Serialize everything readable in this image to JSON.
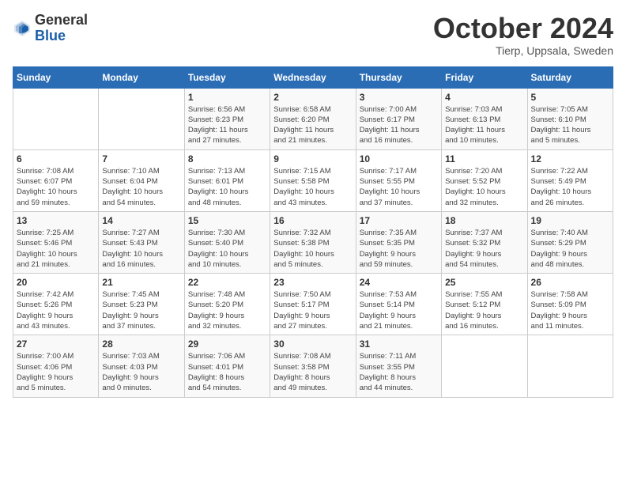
{
  "header": {
    "logo_general": "General",
    "logo_blue": "Blue",
    "month_title": "October 2024",
    "location": "Tierp, Uppsala, Sweden"
  },
  "calendar": {
    "days_of_week": [
      "Sunday",
      "Monday",
      "Tuesday",
      "Wednesday",
      "Thursday",
      "Friday",
      "Saturday"
    ],
    "weeks": [
      [
        {
          "day": "",
          "info": ""
        },
        {
          "day": "",
          "info": ""
        },
        {
          "day": "1",
          "info": "Sunrise: 6:56 AM\nSunset: 6:23 PM\nDaylight: 11 hours\nand 27 minutes."
        },
        {
          "day": "2",
          "info": "Sunrise: 6:58 AM\nSunset: 6:20 PM\nDaylight: 11 hours\nand 21 minutes."
        },
        {
          "day": "3",
          "info": "Sunrise: 7:00 AM\nSunset: 6:17 PM\nDaylight: 11 hours\nand 16 minutes."
        },
        {
          "day": "4",
          "info": "Sunrise: 7:03 AM\nSunset: 6:13 PM\nDaylight: 11 hours\nand 10 minutes."
        },
        {
          "day": "5",
          "info": "Sunrise: 7:05 AM\nSunset: 6:10 PM\nDaylight: 11 hours\nand 5 minutes."
        }
      ],
      [
        {
          "day": "6",
          "info": "Sunrise: 7:08 AM\nSunset: 6:07 PM\nDaylight: 10 hours\nand 59 minutes."
        },
        {
          "day": "7",
          "info": "Sunrise: 7:10 AM\nSunset: 6:04 PM\nDaylight: 10 hours\nand 54 minutes."
        },
        {
          "day": "8",
          "info": "Sunrise: 7:13 AM\nSunset: 6:01 PM\nDaylight: 10 hours\nand 48 minutes."
        },
        {
          "day": "9",
          "info": "Sunrise: 7:15 AM\nSunset: 5:58 PM\nDaylight: 10 hours\nand 43 minutes."
        },
        {
          "day": "10",
          "info": "Sunrise: 7:17 AM\nSunset: 5:55 PM\nDaylight: 10 hours\nand 37 minutes."
        },
        {
          "day": "11",
          "info": "Sunrise: 7:20 AM\nSunset: 5:52 PM\nDaylight: 10 hours\nand 32 minutes."
        },
        {
          "day": "12",
          "info": "Sunrise: 7:22 AM\nSunset: 5:49 PM\nDaylight: 10 hours\nand 26 minutes."
        }
      ],
      [
        {
          "day": "13",
          "info": "Sunrise: 7:25 AM\nSunset: 5:46 PM\nDaylight: 10 hours\nand 21 minutes."
        },
        {
          "day": "14",
          "info": "Sunrise: 7:27 AM\nSunset: 5:43 PM\nDaylight: 10 hours\nand 16 minutes."
        },
        {
          "day": "15",
          "info": "Sunrise: 7:30 AM\nSunset: 5:40 PM\nDaylight: 10 hours\nand 10 minutes."
        },
        {
          "day": "16",
          "info": "Sunrise: 7:32 AM\nSunset: 5:38 PM\nDaylight: 10 hours\nand 5 minutes."
        },
        {
          "day": "17",
          "info": "Sunrise: 7:35 AM\nSunset: 5:35 PM\nDaylight: 9 hours\nand 59 minutes."
        },
        {
          "day": "18",
          "info": "Sunrise: 7:37 AM\nSunset: 5:32 PM\nDaylight: 9 hours\nand 54 minutes."
        },
        {
          "day": "19",
          "info": "Sunrise: 7:40 AM\nSunset: 5:29 PM\nDaylight: 9 hours\nand 48 minutes."
        }
      ],
      [
        {
          "day": "20",
          "info": "Sunrise: 7:42 AM\nSunset: 5:26 PM\nDaylight: 9 hours\nand 43 minutes."
        },
        {
          "day": "21",
          "info": "Sunrise: 7:45 AM\nSunset: 5:23 PM\nDaylight: 9 hours\nand 37 minutes."
        },
        {
          "day": "22",
          "info": "Sunrise: 7:48 AM\nSunset: 5:20 PM\nDaylight: 9 hours\nand 32 minutes."
        },
        {
          "day": "23",
          "info": "Sunrise: 7:50 AM\nSunset: 5:17 PM\nDaylight: 9 hours\nand 27 minutes."
        },
        {
          "day": "24",
          "info": "Sunrise: 7:53 AM\nSunset: 5:14 PM\nDaylight: 9 hours\nand 21 minutes."
        },
        {
          "day": "25",
          "info": "Sunrise: 7:55 AM\nSunset: 5:12 PM\nDaylight: 9 hours\nand 16 minutes."
        },
        {
          "day": "26",
          "info": "Sunrise: 7:58 AM\nSunset: 5:09 PM\nDaylight: 9 hours\nand 11 minutes."
        }
      ],
      [
        {
          "day": "27",
          "info": "Sunrise: 7:00 AM\nSunset: 4:06 PM\nDaylight: 9 hours\nand 5 minutes."
        },
        {
          "day": "28",
          "info": "Sunrise: 7:03 AM\nSunset: 4:03 PM\nDaylight: 9 hours\nand 0 minutes."
        },
        {
          "day": "29",
          "info": "Sunrise: 7:06 AM\nSunset: 4:01 PM\nDaylight: 8 hours\nand 54 minutes."
        },
        {
          "day": "30",
          "info": "Sunrise: 7:08 AM\nSunset: 3:58 PM\nDaylight: 8 hours\nand 49 minutes."
        },
        {
          "day": "31",
          "info": "Sunrise: 7:11 AM\nSunset: 3:55 PM\nDaylight: 8 hours\nand 44 minutes."
        },
        {
          "day": "",
          "info": ""
        },
        {
          "day": "",
          "info": ""
        }
      ]
    ]
  }
}
